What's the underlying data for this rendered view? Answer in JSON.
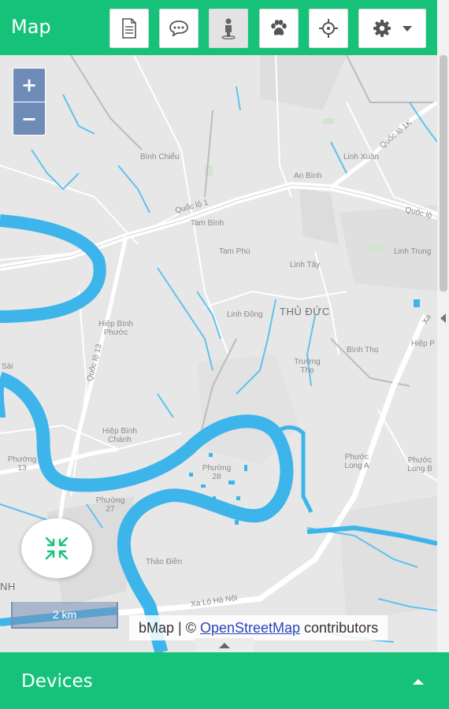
{
  "header": {
    "title": "Map",
    "accent_color": "#16c27a",
    "tools": [
      {
        "icon": "document-icon",
        "active": false
      },
      {
        "icon": "chat-icon",
        "active": false
      },
      {
        "icon": "person-icon",
        "active": true
      },
      {
        "icon": "paw-icon",
        "active": false
      },
      {
        "icon": "crosshair-icon",
        "active": false
      },
      {
        "icon": "gear-icon",
        "active": false
      }
    ]
  },
  "map": {
    "zoom_in": "+",
    "zoom_out": "−",
    "scale_label": "2 km",
    "attribution_prefix": "bMap | ©",
    "attribution_link": "OpenStreetMap",
    "attribution_suffix": "contributors",
    "river_color": "#3db5eb",
    "labels": {
      "binh_chieu": "Bình Chiểu",
      "an_binh": "An Bình",
      "linh_xuan": "Linh Xuân",
      "quoc_lo_1k": "Quốc lộ 1K",
      "quoc_lo_1": "Quốc lộ 1",
      "tam_binh": "Tam Bình",
      "quoc_lo_right": "Quốc lộ",
      "tam_phu": "Tam Phú",
      "linh_tay": "Linh Tây",
      "linh_trung": "Linh Trung",
      "thu_duc": "THỦ ĐỨC",
      "linh_dong": "Linh Đông",
      "hiep_binh_phuoc": "Hiệp Bình Phước",
      "binh_tho": "Bình Thọ",
      "hiep_p": "Hiệp P",
      "truong_tho": "Trường Thọ",
      "quoc_lo_13": "Quốc lộ 13",
      "hiep_binh_chanh": "Hiệp Bình Chánh",
      "phuong_13": "Phường 13",
      "phuong_28": "Phường 28",
      "phuoc_long_a": "Phước Long A",
      "phuoc_long_b": "Phước Long B",
      "phuong_27": "Phường 27",
      "thao_dien": "Thảo Điền",
      "xa_lo_ha_noi": "Xa Lộ Hà Nội",
      "nh": "NH",
      "sai": "Sài",
      "xa": "Xa"
    }
  },
  "footer": {
    "title": "Devices"
  }
}
